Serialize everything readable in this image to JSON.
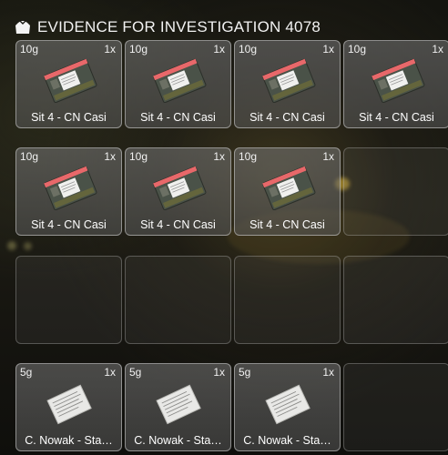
{
  "header": {
    "title": "EVIDENCE FOR INVESTIGATION 4078",
    "icon": "bag-icon"
  },
  "colors": {
    "bag_stripe": "#e8686a",
    "bag_body": "#4a5248",
    "paper": "#e8e8e6"
  },
  "slots": [
    {
      "filled": true,
      "weight": "10g",
      "qty": "1x",
      "label": "Sit 4 - CN Casi",
      "item": "evidence-bag"
    },
    {
      "filled": true,
      "weight": "10g",
      "qty": "1x",
      "label": "Sit 4 - CN Casi",
      "item": "evidence-bag"
    },
    {
      "filled": true,
      "weight": "10g",
      "qty": "1x",
      "label": "Sit 4 - CN Casi",
      "item": "evidence-bag"
    },
    {
      "filled": true,
      "weight": "10g",
      "qty": "1x",
      "label": "Sit 4 - CN Casi",
      "item": "evidence-bag"
    },
    {
      "filled": true,
      "weight": "10g",
      "qty": "1x",
      "label": "Sit 4 - CN Casi",
      "item": "evidence-bag"
    },
    {
      "filled": true,
      "weight": "10g",
      "qty": "1x",
      "label": "Sit 4 - CN Casi",
      "item": "evidence-bag"
    },
    {
      "filled": true,
      "weight": "10g",
      "qty": "1x",
      "label": "Sit 4 - CN Casi",
      "item": "evidence-bag"
    },
    {
      "filled": false
    },
    {
      "filled": false
    },
    {
      "filled": false
    },
    {
      "filled": false
    },
    {
      "filled": false
    },
    {
      "filled": true,
      "weight": "5g",
      "qty": "1x",
      "label": "C. Nowak - Sta…",
      "item": "statement-paper"
    },
    {
      "filled": true,
      "weight": "5g",
      "qty": "1x",
      "label": "C. Nowak - Sta…",
      "item": "statement-paper"
    },
    {
      "filled": true,
      "weight": "5g",
      "qty": "1x",
      "label": "C. Nowak - Sta…",
      "item": "statement-paper"
    },
    {
      "filled": false
    }
  ]
}
